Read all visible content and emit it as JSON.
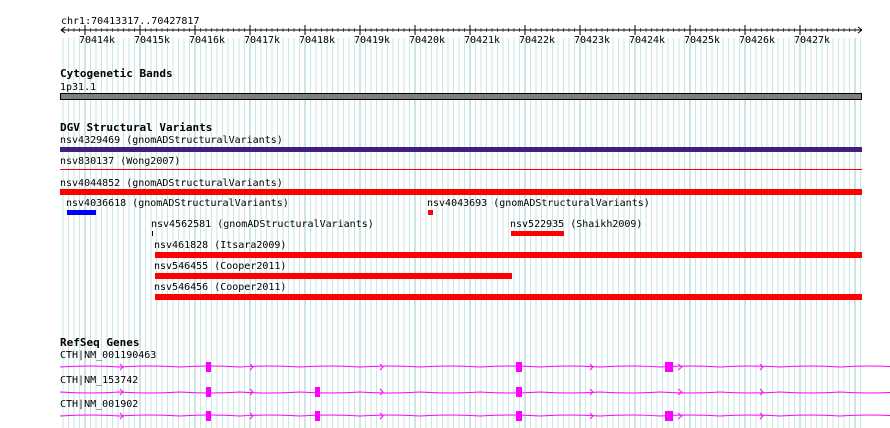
{
  "locus": "chr1:70413317..70427817",
  "ruler": {
    "ticks": [
      "70414k",
      "70415k",
      "70416k",
      "70417k",
      "70418k",
      "70419k",
      "70420k",
      "70421k",
      "70422k",
      "70423k",
      "70424k",
      "70425k",
      "70426k",
      "70427k"
    ]
  },
  "tracks": {
    "cytobands": {
      "title": "Cytogenetic Bands",
      "band_label": "1p31.1",
      "band_color": "#7f7f7f"
    },
    "dgv": {
      "title": "DGV Structural Variants",
      "features": [
        {
          "label": "nsv4329469 (gnomADStructuralVariants)",
          "color": "#40207f"
        },
        {
          "label": "nsv830137 (Wong2007)",
          "color": "#ff0000"
        },
        {
          "label": "nsv4044852 (gnomADStructuralVariants)",
          "color": "#ff0000"
        },
        {
          "label": "nsv4036618 (gnomADStructuralVariants)",
          "color": "#0000ff"
        },
        {
          "label": "nsv4043693 (gnomADStructuralVariants)",
          "color": "#ff0000"
        },
        {
          "label": "nsv4562581 (gnomADStructuralVariants)",
          "color": "#000000"
        },
        {
          "label": "nsv522935 (Shaikh2009)",
          "color": "#ff0000"
        },
        {
          "label": "nsv461828 (Itsara2009)",
          "color": "#ff0000"
        },
        {
          "label": "nsv546455 (Cooper2011)",
          "color": "#ff0000"
        },
        {
          "label": "nsv546456 (Cooper2011)",
          "color": "#ff0000"
        }
      ]
    },
    "refseq": {
      "title": "RefSeq Genes",
      "color": "#ff00ff",
      "transcripts": [
        {
          "label": "CTH|NM_001190463"
        },
        {
          "label": "CTH|NM_153742"
        },
        {
          "label": "CTH|NM_001902"
        }
      ]
    }
  }
}
